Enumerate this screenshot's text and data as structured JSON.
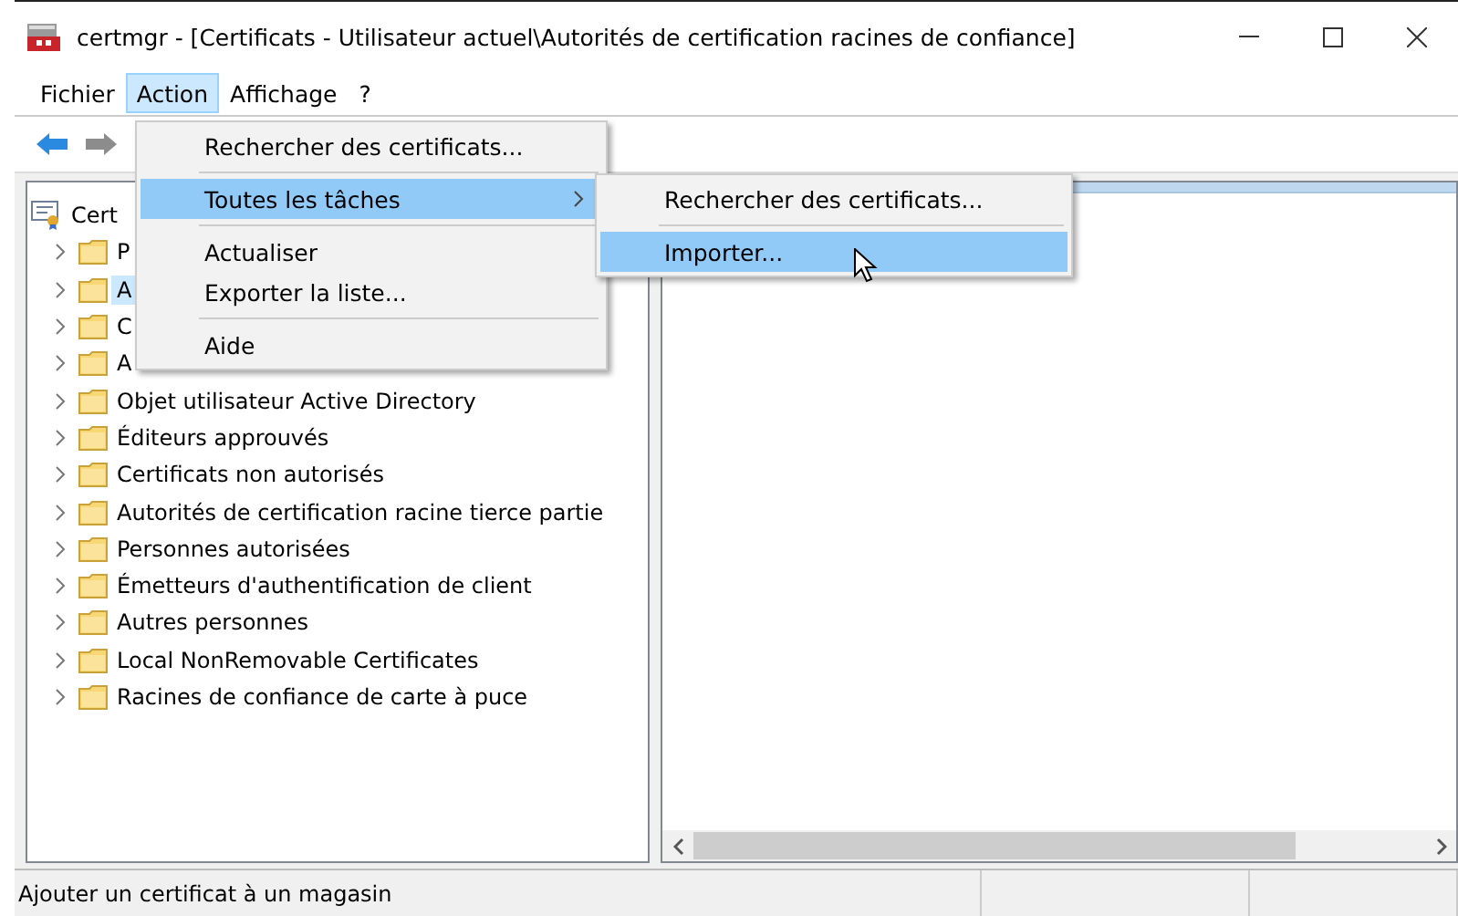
{
  "window": {
    "title": "certmgr - [Certificats - Utilisateur actuel\\Autorités de certification racines de confiance]"
  },
  "menu_bar": [
    {
      "label": "Fichier",
      "selected": false
    },
    {
      "label": "Action",
      "selected": true
    },
    {
      "label": "Affichage",
      "selected": false
    },
    {
      "label": "?",
      "selected": false
    }
  ],
  "tree": {
    "label": "Cert",
    "children": [
      {
        "label": "P",
        "expanded": false,
        "selected": false
      },
      {
        "label": "A",
        "expanded": false,
        "selected": true
      },
      {
        "label": "C",
        "expanded": false,
        "selected": false
      },
      {
        "label": "A",
        "expanded": false,
        "selected": false
      },
      {
        "label": "Objet utilisateur Active Directory",
        "expanded": false,
        "selected": false
      },
      {
        "label": "Éditeurs approuvés",
        "expanded": false,
        "selected": false
      },
      {
        "label": "Certificats non autorisés",
        "expanded": false,
        "selected": false
      },
      {
        "label": "Autorités de certification racine tierce partie",
        "expanded": false,
        "selected": false
      },
      {
        "label": "Personnes autorisées",
        "expanded": false,
        "selected": false
      },
      {
        "label": "Émetteurs d'authentification de client",
        "expanded": false,
        "selected": false
      },
      {
        "label": "Autres personnes",
        "expanded": false,
        "selected": false
      },
      {
        "label": "Local NonRemovable Certificates",
        "expanded": false,
        "selected": false
      },
      {
        "label": "Racines de confiance de carte à puce",
        "expanded": false,
        "selected": false
      }
    ]
  },
  "action_menu": [
    {
      "kind": "item",
      "label": "Rechercher des certificats...",
      "selected": false
    },
    {
      "kind": "separator"
    },
    {
      "kind": "submenu",
      "label": "Toutes les tâches",
      "selected": true
    },
    {
      "kind": "separator"
    },
    {
      "kind": "item",
      "label": "Actualiser",
      "selected": false
    },
    {
      "kind": "item",
      "label": "Exporter la liste...",
      "selected": false
    },
    {
      "kind": "separator"
    },
    {
      "kind": "item",
      "label": "Aide",
      "selected": false
    }
  ],
  "submenu": [
    {
      "kind": "item",
      "label": "Rechercher des certificats...",
      "selected": false
    },
    {
      "kind": "separator"
    },
    {
      "kind": "item",
      "label": "Importer...",
      "selected": true
    }
  ],
  "status_bar": {
    "text": "Ajouter un certificat à un magasin"
  }
}
